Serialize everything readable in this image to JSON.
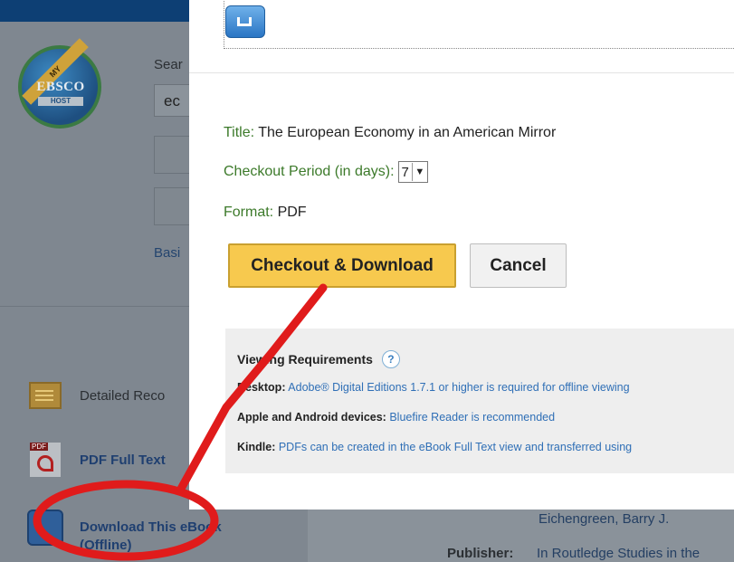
{
  "background": {
    "logo": {
      "ribbon": "MY",
      "brand": "EBSCO",
      "sub": "HOST"
    },
    "search_label": "Sear",
    "search_value": "ec",
    "basic_link": "Basi",
    "side_items": [
      {
        "icon": "folder-icon",
        "label": "Detailed Reco"
      },
      {
        "icon": "pdf-icon",
        "label": "PDF Full Text"
      },
      {
        "icon": "download-icon",
        "label": "Download This eBook (Offline)"
      }
    ],
    "author": "Eichengreen, Barry J.",
    "publisher_label": "Publisher:",
    "publisher_value": "In Routledge Studies in the"
  },
  "modal": {
    "top_icon": "download-icon",
    "title_label": "Title:",
    "title_value": "The European Economy in an American Mirror",
    "period_label": "Checkout Period (in days):",
    "period_value": "7",
    "format_label": "Format:",
    "format_value": "PDF",
    "checkout_button": "Checkout & Download",
    "cancel_button": "Cancel",
    "requirements": {
      "heading": "Viewing Requirements",
      "help_icon": "?",
      "desktop_label": "Desktop:",
      "desktop_link": "Adobe® Digital Editions 1.7.1 or higher is required for offline viewing",
      "mobile_label": "Apple and Android devices:",
      "mobile_link": "Bluefire Reader is recommended",
      "kindle_label": "Kindle:",
      "kindle_link": "PDFs can be created in the eBook Full Text view and transferred using"
    }
  },
  "annotation": {
    "color": "#e01b1b"
  }
}
